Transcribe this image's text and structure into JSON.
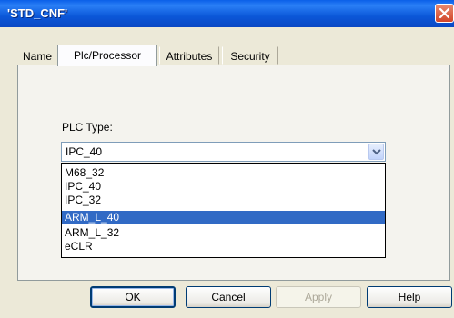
{
  "window": {
    "title": "'STD_CNF'"
  },
  "tabs": [
    {
      "label": "Name"
    },
    {
      "label": "Plc/Processor"
    },
    {
      "label": "Attributes"
    },
    {
      "label": "Security"
    }
  ],
  "plc": {
    "label": "PLC Type:",
    "selected": "IPC_40",
    "options": [
      "M68_32",
      "IPC_40",
      "IPC_32",
      "ARM_L_40",
      "ARM_L_32",
      "eCLR"
    ]
  },
  "buttons": {
    "ok": "OK",
    "cancel": "Cancel",
    "apply": "Apply",
    "help": "Help"
  },
  "colors": {
    "title_bar": "#0a5fe8",
    "selection": "#316ac5",
    "close": "#d2452a"
  }
}
